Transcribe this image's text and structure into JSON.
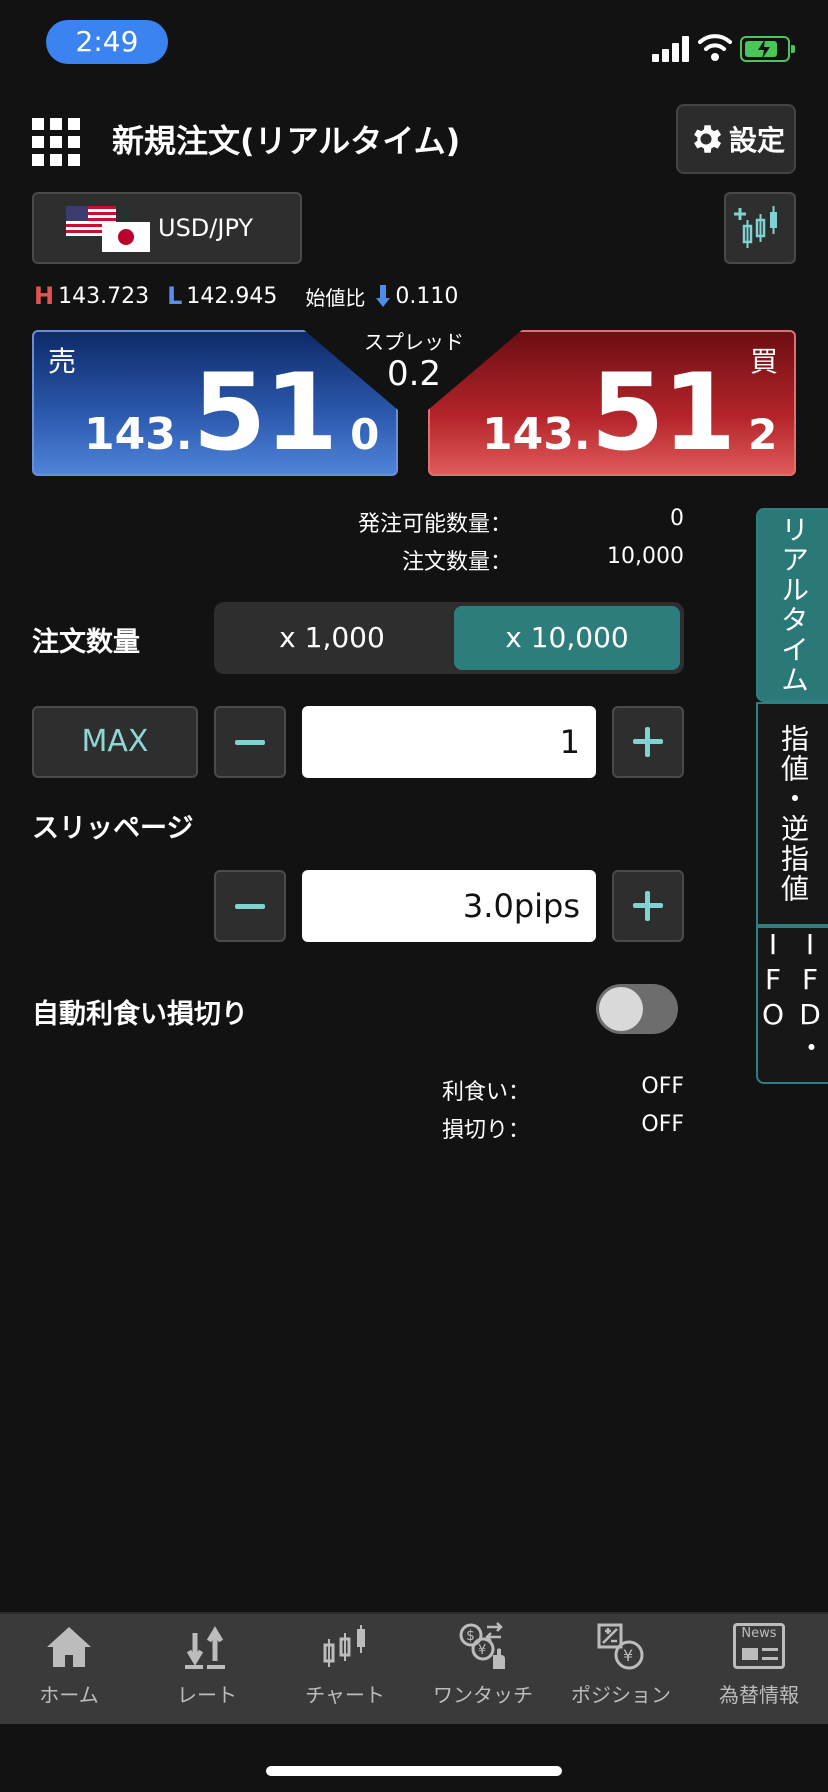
{
  "status_bar": {
    "time": "2:49"
  },
  "header": {
    "title": "新規注文(リアルタイム)",
    "settings_label": "設定"
  },
  "currency": {
    "pair": "USD/JPY"
  },
  "stats": {
    "high_mark": "H",
    "high": "143.723",
    "low_mark": "L",
    "low": "142.945",
    "open_change_label": "始値比",
    "open_change": "0.110"
  },
  "sell": {
    "label": "売",
    "price_pre": "143.",
    "price_big": "51",
    "price_last": "0"
  },
  "buy": {
    "label": "買",
    "price_pre": "143.",
    "price_big": "51",
    "price_last": "2"
  },
  "spread": {
    "label": "スプレッド",
    "value": "0.2"
  },
  "order_info": {
    "available_label": "発注可能数量：",
    "available_value": "0",
    "qty_label": "注文数量：",
    "qty_value": "10,000"
  },
  "side_tabs": [
    "リアルタイム",
    "指値・逆指値",
    "IFD・IFO"
  ],
  "quantity": {
    "label": "注文数量",
    "options": [
      "x 1,000",
      "x 10,000"
    ],
    "selected": "x 10,000",
    "max_label": "MAX",
    "value": "1"
  },
  "slippage": {
    "label": "スリッページ",
    "value": "3.0pips"
  },
  "auto_tpsl": {
    "label": "自動利食い損切り",
    "enabled": false,
    "take_profit_label": "利食い：",
    "take_profit_value": "OFF",
    "stop_loss_label": "損切り：",
    "stop_loss_value": "OFF"
  },
  "nav": [
    {
      "label": "ホーム",
      "icon": "home-icon"
    },
    {
      "label": "レート",
      "icon": "rate-arrows-icon"
    },
    {
      "label": "チャート",
      "icon": "candlestick-icon"
    },
    {
      "label": "ワンタッチ",
      "icon": "one-touch-icon"
    },
    {
      "label": "ポジション",
      "icon": "position-icon"
    },
    {
      "label": "為替情報",
      "icon": "news-icon"
    }
  ],
  "nav_news_badge": "News",
  "colors": {
    "accent": "#2c7d7b",
    "sell": "#2d5bb0",
    "buy": "#b4252b",
    "status_time": "#3a83f1"
  }
}
